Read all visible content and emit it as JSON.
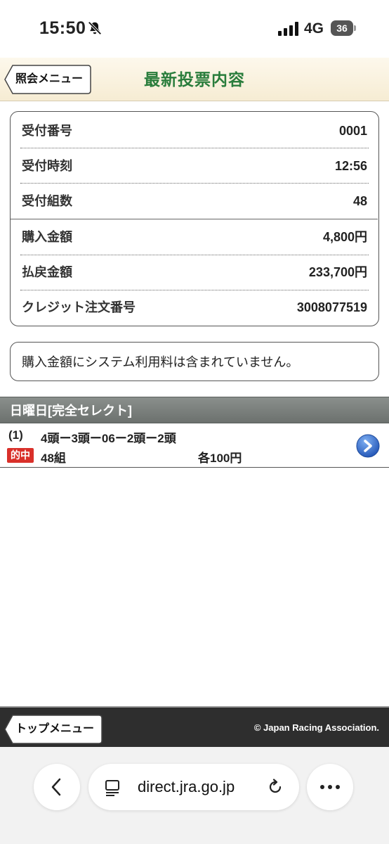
{
  "status_bar": {
    "time": "15:50",
    "network": "4G",
    "battery": "36"
  },
  "header": {
    "back_label": "照会メニュー",
    "title": "最新投票内容"
  },
  "details": [
    {
      "label": "受付番号",
      "value": "0001"
    },
    {
      "label": "受付時刻",
      "value": "12:56"
    },
    {
      "label": "受付組数",
      "value": "48"
    },
    {
      "label": "購入金額",
      "value": "4,800円"
    },
    {
      "label": "払戻金額",
      "value": "233,700円"
    },
    {
      "label": "クレジット注文番号",
      "value": "3008077519"
    }
  ],
  "note": "購入金額にシステム利用料は含まれていません。",
  "section": {
    "title": "日曜日[完全セレクト]"
  },
  "bet": {
    "index": "(1)",
    "combo": "4頭ー3頭ー06ー2頭ー2頭",
    "badge": "的中",
    "groups": "48組",
    "unit": "各100円"
  },
  "footer": {
    "top_menu_label": "トップメニュー",
    "copyright": "© Japan Racing Association."
  },
  "browser": {
    "url": "direct.jra.go.jp"
  },
  "colors": {
    "title_green": "#2a7d3c",
    "hit_red": "#d9302a",
    "arrow_blue": "#2f6fd0"
  }
}
